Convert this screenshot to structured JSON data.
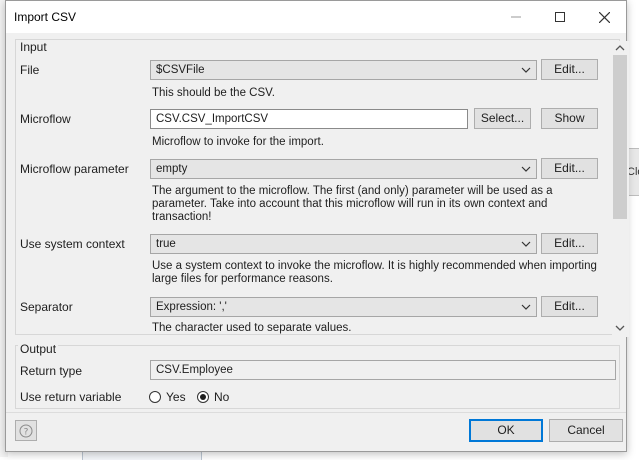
{
  "dialog": {
    "title": "Import CSV",
    "titlebar": {
      "minimize_icon": "minimize-icon",
      "maximize_icon": "maximize-icon",
      "close_icon": "close-icon"
    }
  },
  "input_group": {
    "label": "Input",
    "fields": {
      "file": {
        "label": "File",
        "value": "$CSVFile",
        "button": "Edit...",
        "description": "This should be the CSV."
      },
      "microflow": {
        "label": "Microflow",
        "value": "CSV.CSV_ImportCSV",
        "select_button": "Select...",
        "show_button": "Show",
        "description": "Microflow to invoke for the import."
      },
      "microflow_parameter": {
        "label": "Microflow parameter",
        "value": "empty",
        "button": "Edit...",
        "description_lines": [
          "The argument to the microflow. The first (and only) parameter will be used as a",
          "parameter. Take into account that this microflow will run in its own context and",
          "transaction!"
        ]
      },
      "use_system_context": {
        "label": "Use system context",
        "value": "true",
        "button": "Edit...",
        "description_lines": [
          "Use a system context to invoke the microflow. It is highly recommended when importing",
          "large files for performance reasons."
        ]
      },
      "separator": {
        "label": "Separator",
        "value": "Expression: ','",
        "button": "Edit...",
        "description": "The character used to separate values."
      }
    }
  },
  "output_group": {
    "label": "Output",
    "return_type": {
      "label": "Return type",
      "value": "CSV.Employee"
    },
    "use_return_variable": {
      "label": "Use return variable",
      "options": [
        "Yes",
        "No"
      ],
      "selected": "No"
    }
  },
  "footer": {
    "ok": "OK",
    "cancel": "Cancel",
    "help_icon": "help-icon"
  },
  "background": {
    "right_fragment": "Clo"
  }
}
